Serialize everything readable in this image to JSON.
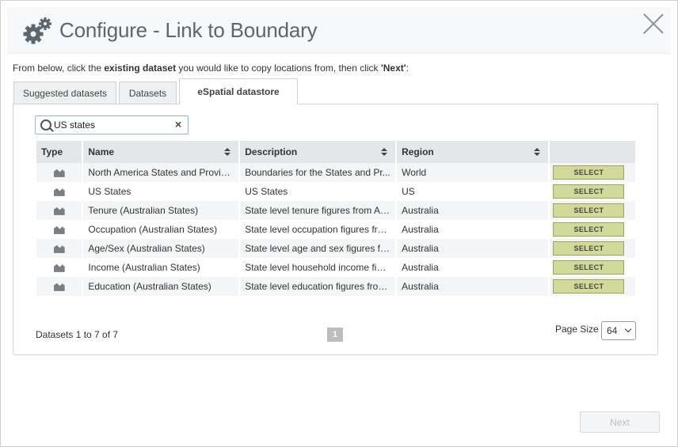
{
  "dialog": {
    "title": "Configure - Link to Boundary",
    "icon": "gears-icon"
  },
  "instruction": {
    "part1": "From below, click the ",
    "bold1": "existing dataset",
    "part2": " you would like to copy locations from, then click ",
    "bold2": "'Next'",
    "part3": ":"
  },
  "tabs": [
    {
      "label": "Suggested datasets",
      "active": false
    },
    {
      "label": "Datasets",
      "active": false
    },
    {
      "label": "eSpatial datastore",
      "active": true
    }
  ],
  "search": {
    "value": "US states",
    "clear_label": "×"
  },
  "table": {
    "headers": [
      "Type",
      "Name",
      "Description",
      "Region"
    ],
    "select_label": "SELECT",
    "rows": [
      {
        "name": "North America States and Provin...",
        "description": "Boundaries for the States and Pr...",
        "region": "World"
      },
      {
        "name": "US States",
        "description": "US States",
        "region": "US"
      },
      {
        "name": "Tenure (Australian States)",
        "description": "State level tenure figures from Au...",
        "region": "Australia"
      },
      {
        "name": "Occupation (Australian States)",
        "description": "State level occupation figures fro...",
        "region": "Australia"
      },
      {
        "name": "Age/Sex (Australian States)",
        "description": "State level age and sex figures fr...",
        "region": "Australia"
      },
      {
        "name": "Income (Australian States)",
        "description": "State level household income figu...",
        "region": "Australia"
      },
      {
        "name": "Education (Australian States)",
        "description": "State level education figures from...",
        "region": "Australia"
      }
    ]
  },
  "footer": {
    "count": "Datasets 1 to 7 of 7",
    "page": "1",
    "page_size_label": "Page Size",
    "page_size": "64"
  },
  "next_label": "Next",
  "colors": {
    "select_button": "#d2da9b",
    "title_text": "#5b6670"
  }
}
